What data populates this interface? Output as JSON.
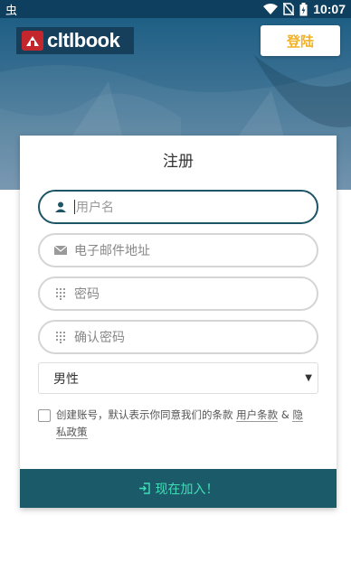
{
  "status_bar": {
    "app_glyph": "虫",
    "time": "10:07",
    "icons": [
      "wifi-icon",
      "no-sim-icon",
      "battery-charging-icon"
    ]
  },
  "header": {
    "logo_text": "cltlbook",
    "login_label": "登陆"
  },
  "form": {
    "title": "注册",
    "username_placeholder": "用户名",
    "email_placeholder": "电子邮件地址",
    "password_placeholder": "密码",
    "confirm_password_placeholder": "确认密码",
    "gender_selected": "男性",
    "agree_text": "创建账号，默认表示你同意我们的条款",
    "terms_link": "用户条款",
    "amp": "&",
    "privacy_link_part1": "隐",
    "privacy_link_part2": "私政策",
    "join_label": "现在加入！"
  },
  "colors": {
    "header_bg": "#0f3f5e",
    "accent_gold": "#f0b22a",
    "join_bg": "#1b5a68",
    "join_text": "#3fe0b8",
    "active_border": "#1d5466"
  }
}
